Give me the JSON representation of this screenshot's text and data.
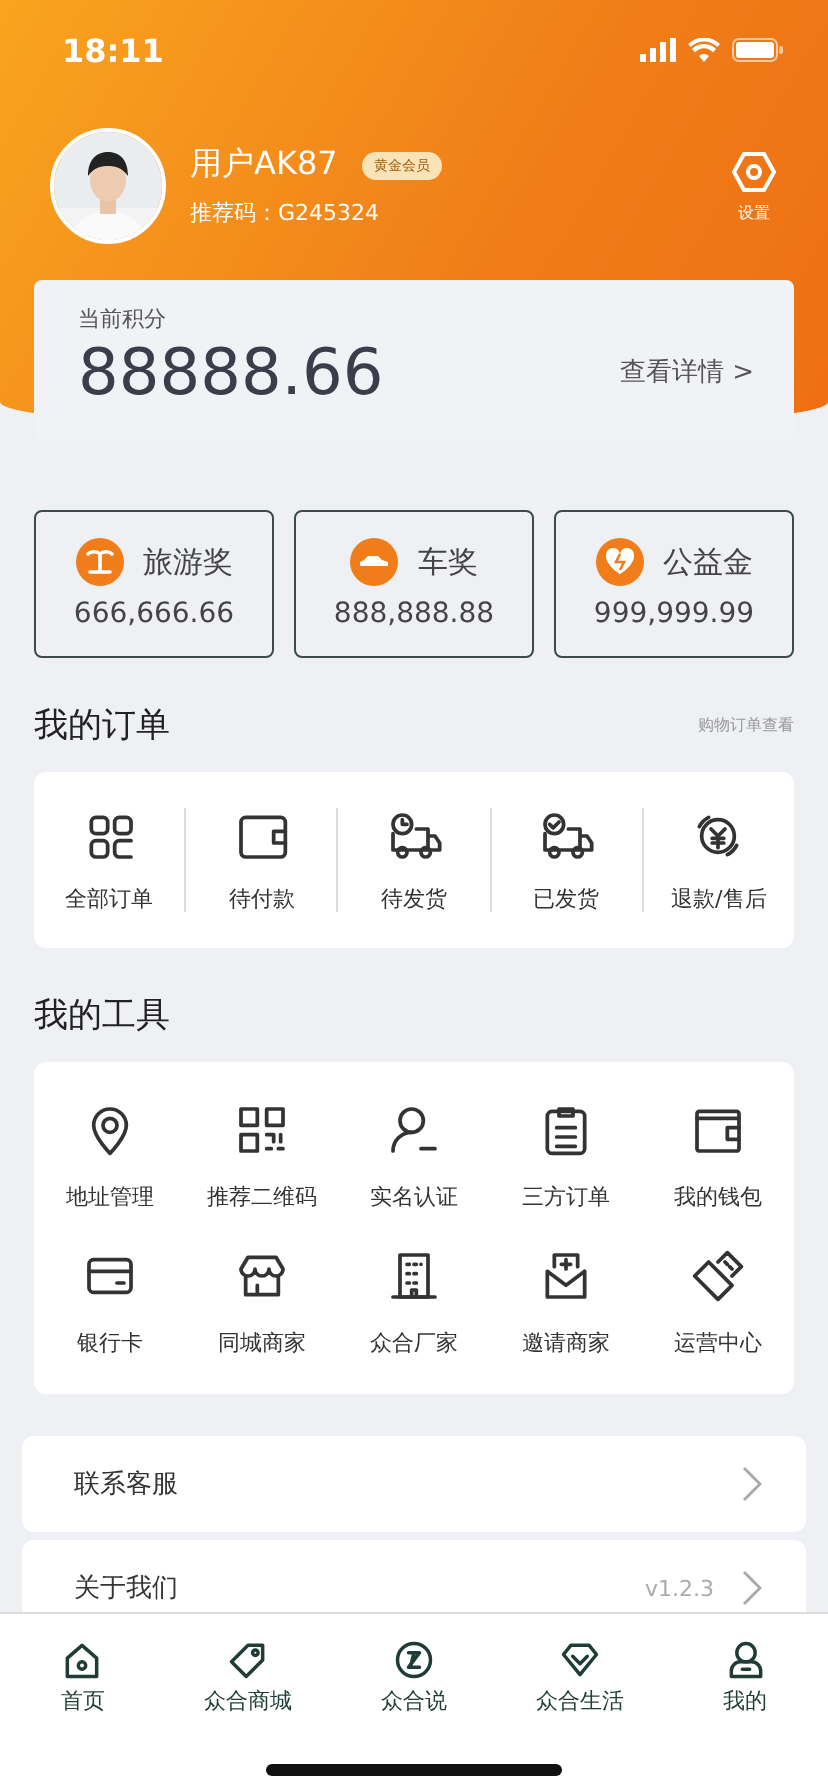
{
  "status_bar": {
    "time": "18:11"
  },
  "profile": {
    "username": "用户AK87",
    "badge": "黄金会员",
    "referral": "推荐码：G245324",
    "settings_label": "设置"
  },
  "points": {
    "label": "当前积分",
    "value": "88888.66",
    "link": "查看详情 >"
  },
  "rewards": [
    {
      "label": "旅游奖",
      "value": "666,666.66"
    },
    {
      "label": "车奖",
      "value": "888,888.88"
    },
    {
      "label": "公益金",
      "value": "999,999.99"
    }
  ],
  "orders": {
    "title": "我的订单",
    "link": "购物订单查看",
    "items": [
      "全部订单",
      "待付款",
      "待发货",
      "已发货",
      "退款/售后"
    ]
  },
  "tools": {
    "title": "我的工具",
    "items": [
      "地址管理",
      "推荐二维码",
      "实名认证",
      "三方订单",
      "我的钱包",
      "银行卡",
      "同城商家",
      "众合厂家",
      "邀请商家",
      "运营中心"
    ]
  },
  "menu": [
    {
      "label": "联系客服"
    },
    {
      "label": "关于我们",
      "value": "v1.2.3"
    }
  ],
  "tab_bar": [
    {
      "label": "首页"
    },
    {
      "label": "众合商城"
    },
    {
      "label": "众合说"
    },
    {
      "label": "众合生活"
    },
    {
      "label": "我的"
    }
  ]
}
